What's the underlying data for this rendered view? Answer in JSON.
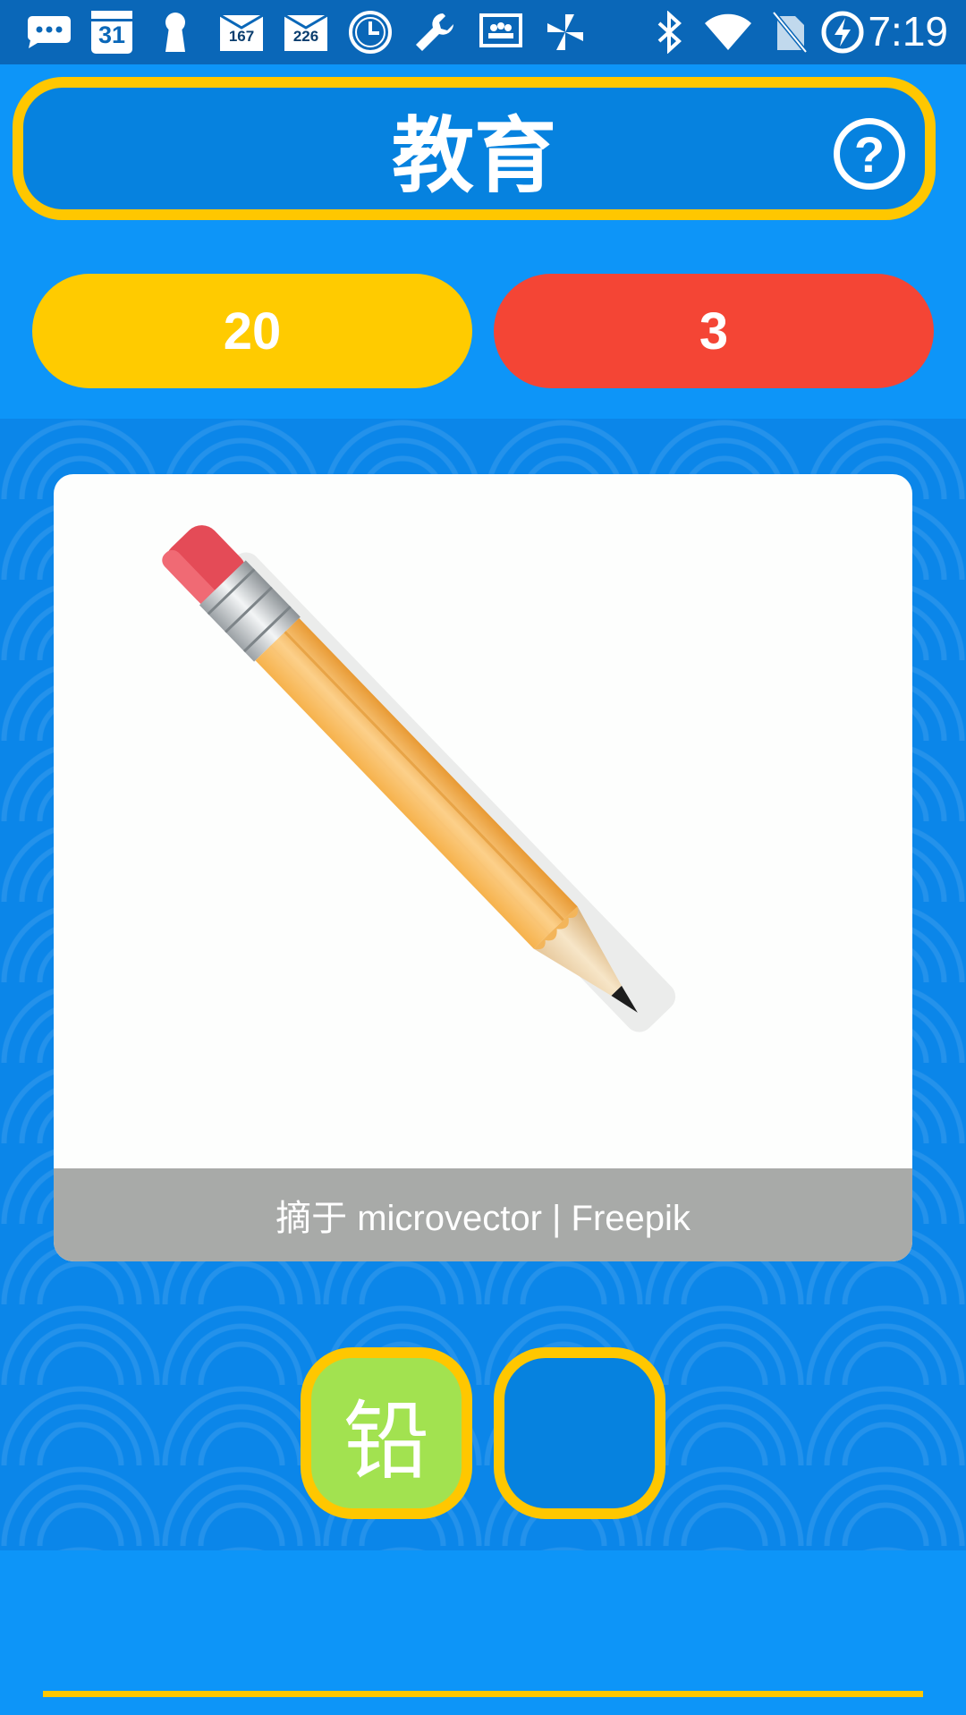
{
  "status_bar": {
    "time": "7:19",
    "calendar_day": "31",
    "badge_a": "167",
    "badge_b": "226",
    "icons": [
      "chat-icon",
      "calendar-icon",
      "keyhole-icon",
      "mail-badge-icon",
      "mail-badge-icon",
      "clock-icon",
      "wrench-icon",
      "slideshow-icon",
      "pinwheel-icon",
      "bluetooth-icon",
      "wifi-icon",
      "no-sim-icon",
      "battery-charging-icon"
    ]
  },
  "header": {
    "title": "教育",
    "help_symbol": "?"
  },
  "scores": {
    "correct": "20",
    "wrong": "3"
  },
  "image_card": {
    "subject": "pencil-illustration",
    "credit": "摘于 microvector | Freepik"
  },
  "answer": {
    "slots": [
      "铅",
      ""
    ]
  },
  "colors": {
    "background": "#0d95f8",
    "header_fill": "#0682df",
    "accent_yellow": "#ffc700",
    "wrong_red": "#f44535",
    "correct_green": "#a2e250"
  }
}
